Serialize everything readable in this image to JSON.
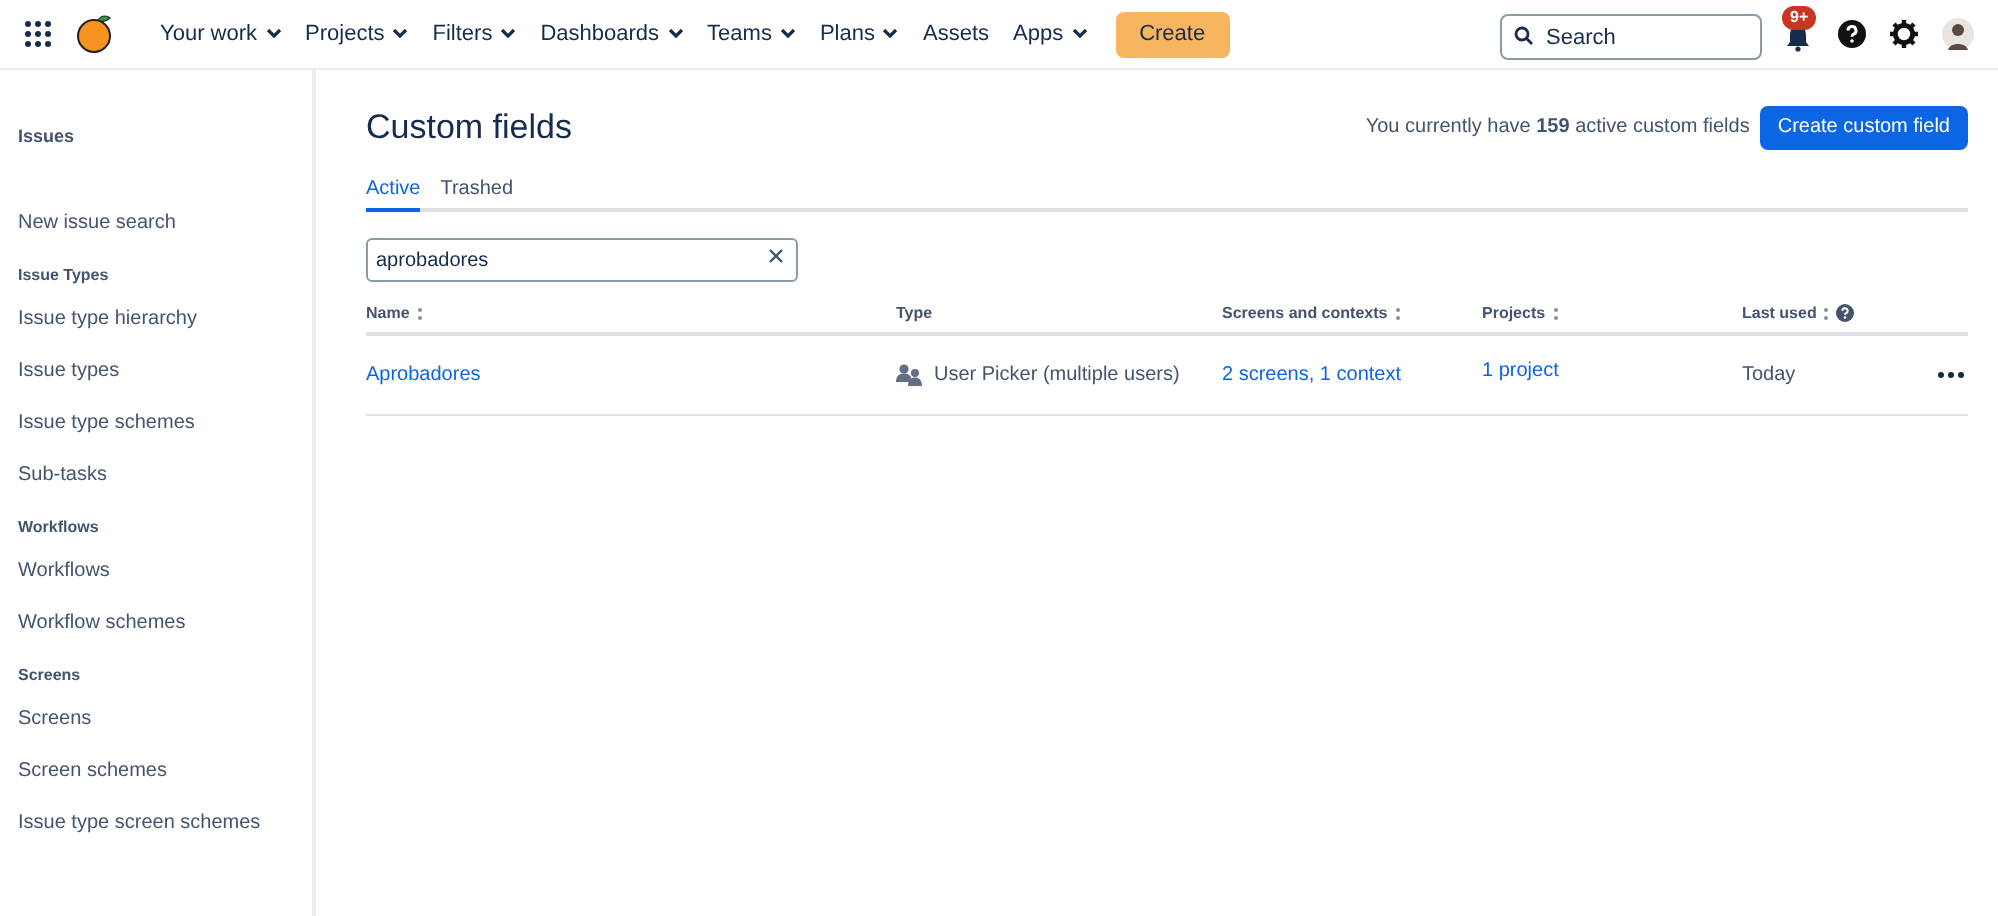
{
  "top_nav": {
    "items": [
      {
        "label": "Your work",
        "has_menu": true
      },
      {
        "label": "Projects",
        "has_menu": true
      },
      {
        "label": "Filters",
        "has_menu": true
      },
      {
        "label": "Dashboards",
        "has_menu": true
      },
      {
        "label": "Teams",
        "has_menu": true
      },
      {
        "label": "Plans",
        "has_menu": true
      },
      {
        "label": "Assets",
        "has_menu": false
      },
      {
        "label": "Apps",
        "has_menu": true
      }
    ],
    "create_button": "Create",
    "search": {
      "placeholder": "Search"
    },
    "notifications_badge": "9+"
  },
  "sidebar": {
    "title": "Issues",
    "items": [
      {
        "kind": "link",
        "label": "New issue search"
      },
      {
        "kind": "heading",
        "label": "Issue Types"
      },
      {
        "kind": "link",
        "label": "Issue type hierarchy"
      },
      {
        "kind": "link",
        "label": "Issue types"
      },
      {
        "kind": "link",
        "label": "Issue type schemes"
      },
      {
        "kind": "link",
        "label": "Sub-tasks"
      },
      {
        "kind": "heading",
        "label": "Workflows"
      },
      {
        "kind": "link",
        "label": "Workflows"
      },
      {
        "kind": "link",
        "label": "Workflow schemes"
      },
      {
        "kind": "heading",
        "label": "Screens"
      },
      {
        "kind": "link",
        "label": "Screens"
      },
      {
        "kind": "link",
        "label": "Screen schemes"
      },
      {
        "kind": "link",
        "label": "Issue type screen schemes"
      }
    ]
  },
  "page": {
    "title": "Custom fields",
    "summary": "You currently have **159** active custom fields",
    "create_button": "Create custom field",
    "tabs": [
      {
        "label": "Active",
        "selected": true
      },
      {
        "label": "Trashed",
        "selected": false
      }
    ],
    "filter": {
      "value": "aprobadores"
    },
    "table": {
      "columns": [
        {
          "label": "Name",
          "sortable": true,
          "help": false
        },
        {
          "label": "Type",
          "sortable": false,
          "help": false
        },
        {
          "label": "Screens and contexts",
          "sortable": true,
          "help": false
        },
        {
          "label": "Projects",
          "sortable": true,
          "help": false
        },
        {
          "label": "Last used",
          "sortable": true,
          "help": true
        }
      ],
      "rows": [
        {
          "name": "Aprobadores",
          "type": "User Picker (multiple users)",
          "screens": "2 screens, 1 context",
          "projects": "1 project",
          "last_used": "Today"
        }
      ]
    }
  }
}
